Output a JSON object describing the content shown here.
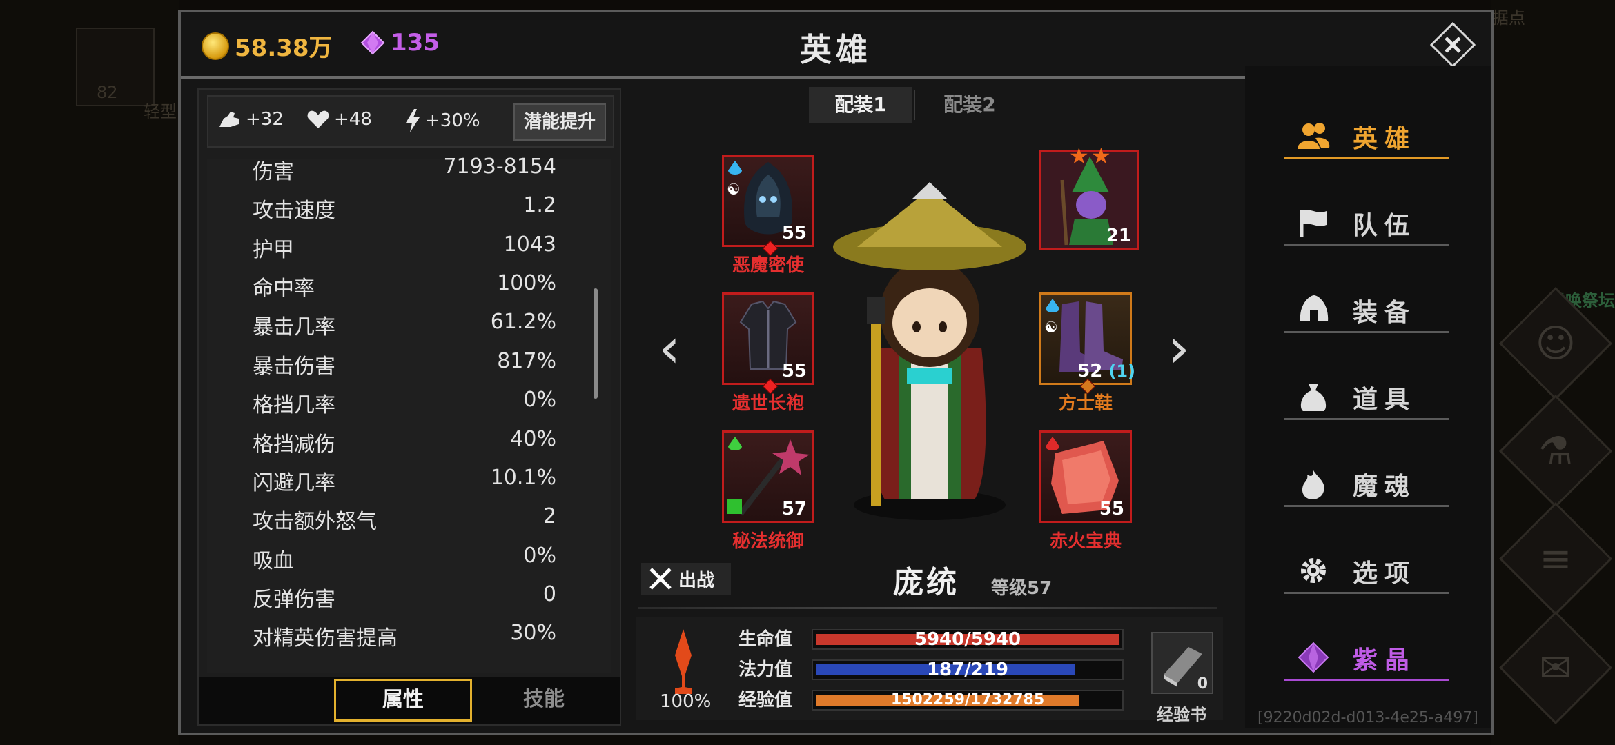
{
  "currency": {
    "gold": "58.38万",
    "gems": "135"
  },
  "title": "英雄",
  "background_text": {
    "top_right": "据点",
    "left_count": "82",
    "left_label": "轻型",
    "right_label": "召唤祭坛"
  },
  "bonuses": [
    {
      "icon": "strength-icon",
      "value": "+32"
    },
    {
      "icon": "heart-icon",
      "value": "+48"
    },
    {
      "icon": "lightning-icon",
      "value": "+30%"
    }
  ],
  "boost_button": "潜能提升",
  "stats": [
    {
      "label": "伤害",
      "value": "7193-8154"
    },
    {
      "label": "攻击速度",
      "value": "1.2"
    },
    {
      "label": "护甲",
      "value": "1043"
    },
    {
      "label": "命中率",
      "value": "100%"
    },
    {
      "label": "暴击几率",
      "value": "61.2%"
    },
    {
      "label": "暴击伤害",
      "value": "817%"
    },
    {
      "label": "格挡几率",
      "value": "0%"
    },
    {
      "label": "格挡减伤",
      "value": "40%"
    },
    {
      "label": "闪避几率",
      "value": "10.1%"
    },
    {
      "label": "攻击额外怒气",
      "value": "2"
    },
    {
      "label": "吸血",
      "value": "0%"
    },
    {
      "label": "反弹伤害",
      "value": "0"
    },
    {
      "label": "对精英伤害提高",
      "value": "30%"
    }
  ],
  "stat_tabs": {
    "attributes": "属性",
    "skills": "技能"
  },
  "loadout_tabs": [
    "配装1",
    "配装2"
  ],
  "equipment": {
    "helmet": {
      "name": "恶魔密使",
      "level": "55"
    },
    "pet": {
      "level": "21",
      "stars": 2
    },
    "robe": {
      "name": "遗世长袍",
      "level": "55"
    },
    "boots": {
      "name": "方士鞋",
      "level": "52",
      "bonus": "(1)"
    },
    "weapon": {
      "name": "秘法统御",
      "level": "57"
    },
    "book": {
      "name": "赤火宝典",
      "level": "55"
    }
  },
  "deploy_label": "出战",
  "hero": {
    "name": "庞统",
    "level_text": "等级57"
  },
  "power_percent": "100%",
  "bars": [
    {
      "label": "生命值",
      "text": "5940/5940",
      "fill": 1.0,
      "color": "#c8382c"
    },
    {
      "label": "法力值",
      "text": "187/219",
      "fill": 0.854,
      "color": "#2a48b8"
    },
    {
      "label": "经验值",
      "text": "1502259/1732785",
      "fill": 0.867,
      "color": "#e07a2a"
    }
  ],
  "exp_book": {
    "count": "0",
    "label": "经验书"
  },
  "menu": [
    {
      "label": "英雄",
      "icon": "heroes-icon",
      "state": "active"
    },
    {
      "label": "队伍",
      "icon": "flag-icon",
      "state": "normal"
    },
    {
      "label": "装备",
      "icon": "helmet-icon",
      "state": "normal"
    },
    {
      "label": "道具",
      "icon": "bag-icon",
      "state": "normal"
    },
    {
      "label": "魔魂",
      "icon": "flame-icon",
      "state": "normal"
    },
    {
      "label": "选项",
      "icon": "gear-icon",
      "state": "normal"
    },
    {
      "label": "紫晶",
      "icon": "amethyst-icon",
      "state": "purple"
    }
  ],
  "build_id": "[9220d02d-d013-4e25-a497]"
}
